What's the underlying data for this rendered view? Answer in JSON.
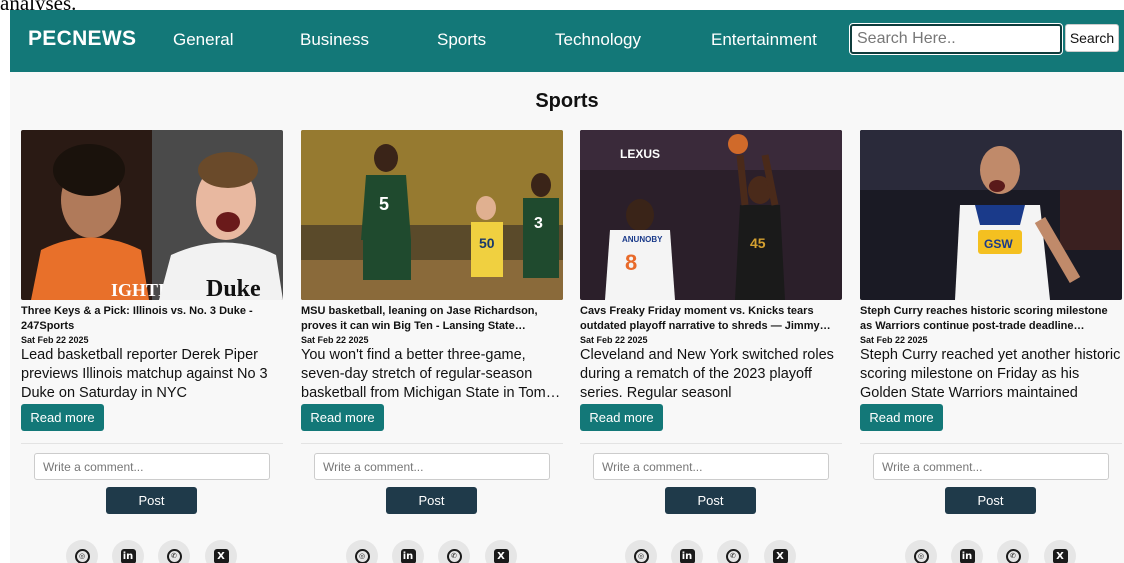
{
  "page_top_clip": "analyses.",
  "navbar": {
    "brand": "PECNEWS",
    "links": [
      "General",
      "Business",
      "Sports",
      "Technology",
      "Entertainment"
    ],
    "search_placeholder": "Search Here..",
    "search_button": "Search"
  },
  "section_title": "Sports",
  "articles": [
    {
      "image_icon": "basketball-players-photo",
      "headline": "Three Keys & a Pick: Illinois vs. No. 3 Duke - 247Sports",
      "date": "Sat Feb 22 2025",
      "description": "Lead basketball reporter Derek Piper previews Illinois matchup against No 3 Duke on Saturday in NYC",
      "read_more": "Read more",
      "comment_placeholder": "Write a comment...",
      "post": "Post"
    },
    {
      "image_icon": "basketball-game-photo",
      "headline": "MSU basketball, leaning on Jase Richardson, proves it can win Big Ten - Lansing State…",
      "date": "Sat Feb 22 2025",
      "description": "You won't find a better three-game, seven-day stretch of regular-season basketball from Michigan State in Tom…",
      "read_more": "Read more",
      "comment_placeholder": "Write a comment...",
      "post": "Post"
    },
    {
      "image_icon": "basketball-shot-photo",
      "headline": "Cavs Freaky Friday moment vs. Knicks tears outdated playoff narrative to shreds — Jimmy…",
      "date": "Sat Feb 22 2025",
      "description": "Cleveland and New York switched roles during a rematch of the 2023 playoff series. Regular seasonl",
      "read_more": "Read more",
      "comment_placeholder": "Write a comment...",
      "post": "Post"
    },
    {
      "image_icon": "basketball-player-celebrating-photo",
      "headline": "Steph Curry reaches historic scoring milestone as Warriors continue post-trade deadline…",
      "date": "Sat Feb 22 2025",
      "description": "Steph Curry reached yet another historic scoring milestone on Friday as his Golden State Warriors maintained their…",
      "read_more": "Read more",
      "comment_placeholder": "Write a comment...",
      "post": "Post"
    }
  ],
  "share_icons": [
    {
      "name": "instagram-icon",
      "glyph": "◎"
    },
    {
      "name": "linkedin-icon",
      "glyph": "in"
    },
    {
      "name": "whatsapp-icon",
      "glyph": "✆"
    },
    {
      "name": "x-icon",
      "glyph": "X"
    }
  ],
  "colors": {
    "navbar": "#137878",
    "accent": "#137878",
    "post_button": "#1f3a4a"
  }
}
